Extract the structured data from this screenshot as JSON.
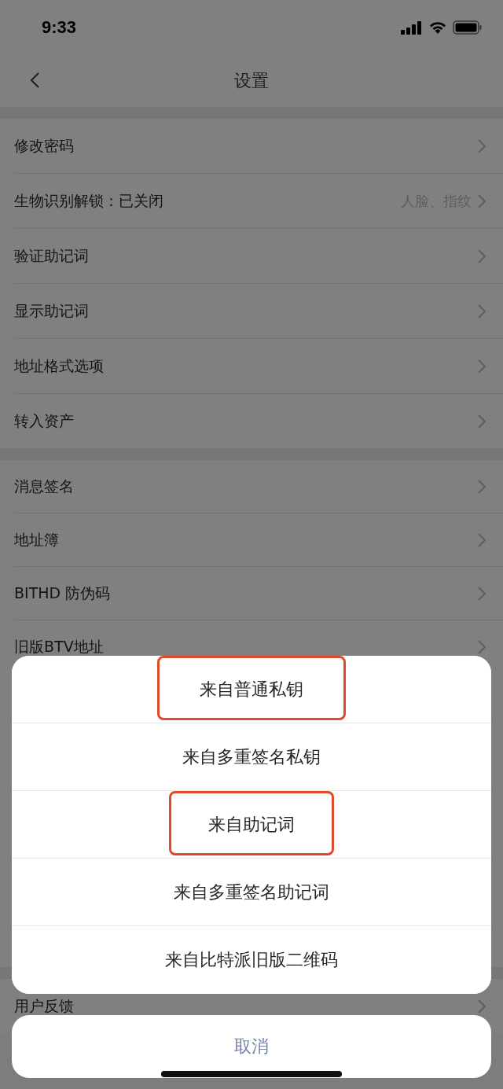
{
  "status_bar": {
    "time": "9:33"
  },
  "nav": {
    "title": "设置"
  },
  "groups": [
    {
      "rows": [
        {
          "label": "修改密码"
        },
        {
          "label": "生物识别解锁：已关闭",
          "value": "人脸、指纹"
        },
        {
          "label": "验证助记词"
        },
        {
          "label": "显示助记词"
        },
        {
          "label": "地址格式选项"
        },
        {
          "label": "转入资产"
        }
      ]
    },
    {
      "rows": [
        {
          "label": "消息签名"
        },
        {
          "label": "地址簿"
        },
        {
          "label": "BITHD 防伪码"
        },
        {
          "label": "旧版BTV地址"
        }
      ]
    },
    {
      "rows": [
        {
          "label": "用户反馈"
        }
      ]
    }
  ],
  "action_sheet": {
    "options": [
      {
        "label": "来自普通私钥",
        "highlighted": true
      },
      {
        "label": "来自多重签名私钥",
        "highlighted": false
      },
      {
        "label": "来自助记词",
        "highlighted": true
      },
      {
        "label": "来自多重签名助记词",
        "highlighted": false
      },
      {
        "label": "来自比特派旧版二维码",
        "highlighted": false
      }
    ],
    "cancel": "取消"
  }
}
